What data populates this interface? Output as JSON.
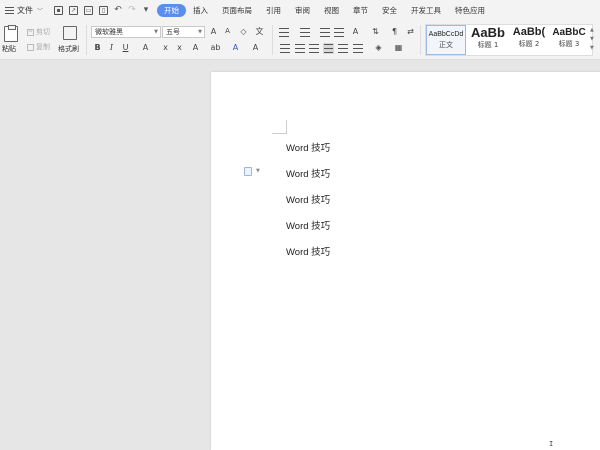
{
  "menu": {
    "file_label": "文件",
    "tabs": [
      {
        "label": "开始",
        "active": true
      },
      {
        "label": "插入"
      },
      {
        "label": "页面布局"
      },
      {
        "label": "引用"
      },
      {
        "label": "审阅"
      },
      {
        "label": "视图"
      },
      {
        "label": "章节"
      },
      {
        "label": "安全"
      },
      {
        "label": "开发工具"
      },
      {
        "label": "特色应用"
      }
    ],
    "accent_color": "#5b8def"
  },
  "ribbon": {
    "paste_label": "粘贴",
    "cut_label": "剪切",
    "copy_label": "复制",
    "format_painter_label": "格式刷",
    "font_name": "微软雅黑",
    "font_size": "五号",
    "styles": [
      {
        "sample": "AaBbCcDd",
        "name": "正文",
        "selected": true
      },
      {
        "sample": "AaBb",
        "name": "标题 1"
      },
      {
        "sample": "AaBb(",
        "name": "标题 2"
      },
      {
        "sample": "AaBbC",
        "name": "标题 3"
      }
    ]
  },
  "document": {
    "lines": [
      "Word 技巧",
      "Word 技巧",
      "Word 技巧",
      "Word 技巧",
      "Word 技巧"
    ],
    "cursor_glyph": "I"
  }
}
